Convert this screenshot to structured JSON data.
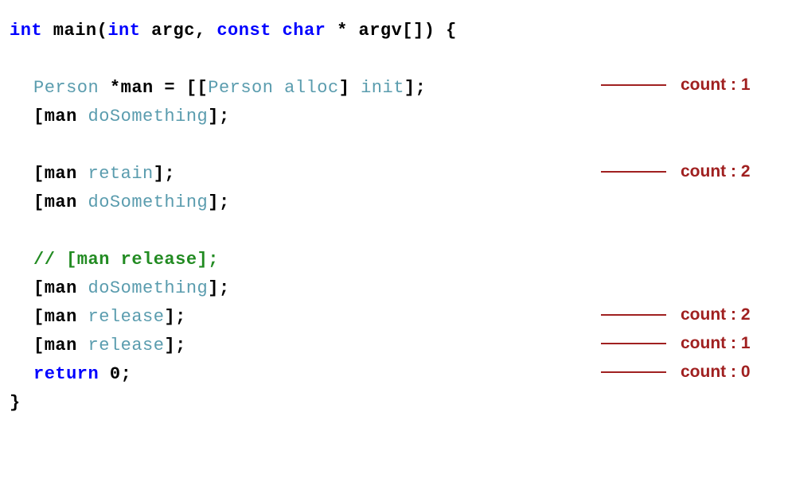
{
  "code": {
    "l1_int": "int",
    "l1_main": " main(",
    "l1_int2": "int",
    "l1_argc": " argc, ",
    "l1_const": "const",
    "l1_space": " ",
    "l1_char": "char",
    "l1_argv": " * argv[]) {",
    "l3_person": "Person",
    "l3_man": " *man = [[",
    "l3_person2": "Person",
    "l3_space": " ",
    "l3_alloc": "alloc",
    "l3_bracket": "] ",
    "l3_init": "init",
    "l3_end": "];",
    "l4_man": "[man ",
    "l4_do": "doSomething",
    "l4_end": "];",
    "l6_man": "[man ",
    "l6_retain": "retain",
    "l6_end": "];",
    "l7_man": "[man ",
    "l7_do": "doSomething",
    "l7_end": "];",
    "l9_comment": "// [man release];",
    "l10_man": "[man ",
    "l10_do": "doSomething",
    "l10_end": "];",
    "l11_man": "[man ",
    "l11_release": "release",
    "l11_end": "];",
    "l12_man": "[man ",
    "l12_release": "release",
    "l12_end": "];",
    "l13_return": "return",
    "l13_zero": " 0;",
    "l14_brace": "}"
  },
  "annotations": {
    "a1": "count : 1",
    "a2": "count : 2",
    "a3": "count : 2",
    "a4": "count : 1",
    "a5": "count : 0"
  }
}
